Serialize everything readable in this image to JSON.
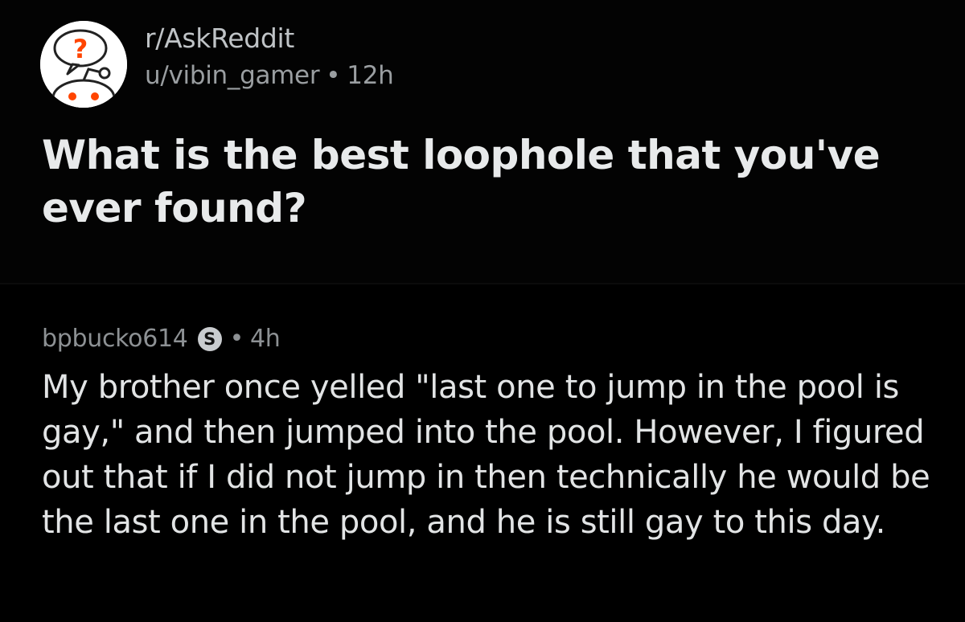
{
  "post": {
    "subreddit": "r/AskReddit",
    "author": "u/vibin_gamer",
    "separator": "•",
    "age": "12h",
    "title": "What is the best loophole that you've ever found?",
    "avatar_icon": "askreddit-snoo-icon"
  },
  "comment": {
    "author": "bpbucko614",
    "badge": "S",
    "badge_icon": "flair-s-icon",
    "separator": "•",
    "age": "4h",
    "body": "My brother once yelled \"last one to jump in the pool is gay,\" and then jumped into the pool. However, I figured out that if I did not jump in then technically he would be the last one in the pool, and he is still gay to this day."
  },
  "colors": {
    "background": "#000000",
    "title_text": "#e8eaeb",
    "meta_text": "#9a9ea1",
    "body_text": "#e2e4e5"
  }
}
